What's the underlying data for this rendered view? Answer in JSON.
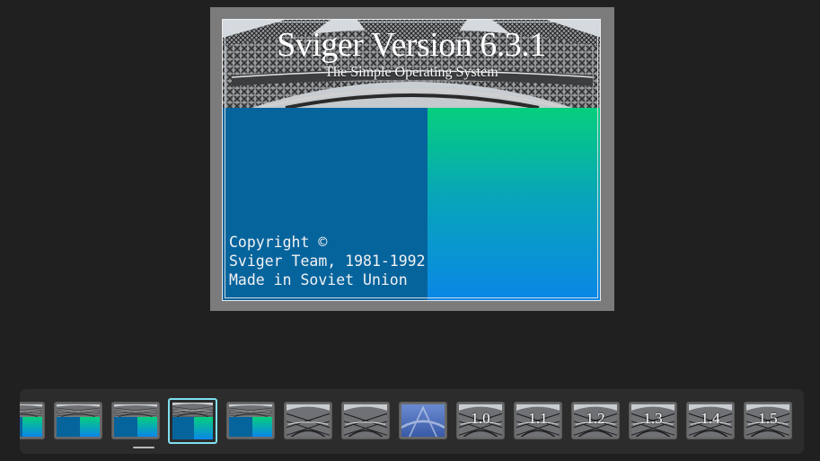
{
  "preview": {
    "title": "Sviger Version 6.3.1",
    "subtitle": "The Simple Operating System",
    "copyright_lines": [
      "Copyright ©",
      "Sviger Team, 1981-1992",
      "Made in Soviet Union"
    ]
  },
  "filmstrip": {
    "selected_index": 3,
    "thumbs": [
      {
        "kind": "splash",
        "label": ""
      },
      {
        "kind": "splash",
        "label": ""
      },
      {
        "kind": "splash",
        "label": ""
      },
      {
        "kind": "splash",
        "label": ""
      },
      {
        "kind": "splash",
        "label": ""
      },
      {
        "kind": "tower",
        "label": ""
      },
      {
        "kind": "tower",
        "label": ""
      },
      {
        "kind": "blue",
        "label": ""
      },
      {
        "kind": "tower",
        "label": "1.0"
      },
      {
        "kind": "tower",
        "label": "1.1"
      },
      {
        "kind": "tower",
        "label": "1.2"
      },
      {
        "kind": "tower",
        "label": "1.3"
      },
      {
        "kind": "tower",
        "label": "1.4"
      },
      {
        "kind": "tower",
        "label": "1.5"
      }
    ]
  },
  "colors": {
    "background": "#202020",
    "frame": "#7b7b7b",
    "splash_blue": "#06649d",
    "gradient_top": "#05cf7d",
    "gradient_bottom": "#0a86e8",
    "selection_accent": "#7ee0f0"
  }
}
